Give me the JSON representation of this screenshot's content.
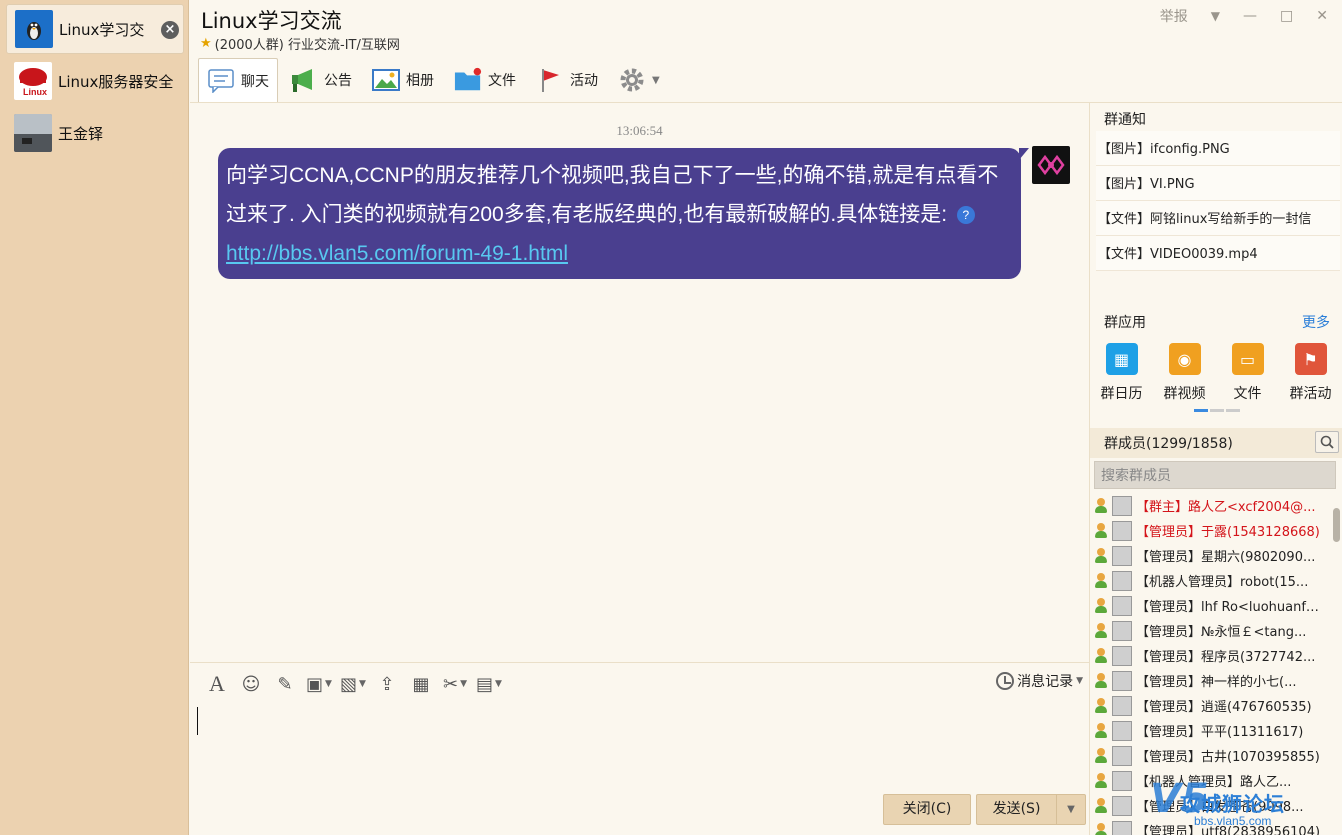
{
  "conversations": [
    {
      "name": "Linux学习交",
      "active": true
    },
    {
      "name": "Linux服务器安全",
      "active": false
    },
    {
      "name": "王金铎",
      "active": false
    }
  ],
  "header": {
    "title": "Linux学习交流",
    "subtitle": "(2000人群) 行业交流-IT/互联网",
    "report": "举报"
  },
  "tabs": [
    {
      "label": "聊天",
      "icon": "chat-icon"
    },
    {
      "label": "公告",
      "icon": "megaphone-icon"
    },
    {
      "label": "相册",
      "icon": "photo-album-icon"
    },
    {
      "label": "文件",
      "icon": "folder-icon"
    },
    {
      "label": "活动",
      "icon": "flag-icon"
    }
  ],
  "chat": {
    "timestamp": "13:06:54",
    "message_text": "向学习CCNA,CCNP的朋友推荐几个视频吧,我自己下了一些,的确不错,就是有点看不过来了. 入门类的视频就有200多套,有老版经典的,也有最新破解的.具体链接是:",
    "message_link": "http://bbs.vlan5.com/forum-49-1.html"
  },
  "input": {
    "history_label": "消息记录",
    "close_label": "关闭(C)",
    "send_label": "发送(S)"
  },
  "right": {
    "notice_title": "群通知",
    "notices": [
      {
        "kind": "【图片】",
        "name": "ifconfig.PNG"
      },
      {
        "kind": "【图片】",
        "name": "VI.PNG"
      },
      {
        "kind": "【文件】",
        "name": "阿铭linux写给新手的一封信"
      },
      {
        "kind": "【文件】",
        "name": "VIDEO0039.mp4"
      }
    ],
    "apps_title": "群应用",
    "apps_more": "更多",
    "apps": [
      {
        "label": "群日历",
        "icon": "calendar-icon",
        "color": "#1ea0e6"
      },
      {
        "label": "群视频",
        "icon": "video-camera-icon",
        "color": "#f0a020"
      },
      {
        "label": "文件",
        "icon": "folder-icon",
        "color": "#f0a020"
      },
      {
        "label": "群活动",
        "icon": "activity-icon",
        "color": "#e0553a"
      }
    ],
    "members_title": "群成员(1299/1858)",
    "member_search_placeholder": "搜索群成员",
    "members": [
      {
        "text": "【群主】路人乙<xcf2004@...",
        "red": true
      },
      {
        "text": "【管理员】于露(1543128668)",
        "red": true
      },
      {
        "text": "【管理员】星期六(9802090...",
        "red": false
      },
      {
        "text": "【机器人管理员】robot(15...",
        "red": false
      },
      {
        "text": "【管理员】lhf Ro<luohuanfe...",
        "red": false
      },
      {
        "text": "【管理员】№永恒￡<tang...",
        "red": false
      },
      {
        "text": "【管理员】程序员(3727742...",
        "red": false
      },
      {
        "text": "【管理员】神一样的小七(...",
        "red": false
      },
      {
        "text": "【管理员】逍遥(476760535)",
        "red": false
      },
      {
        "text": "【管理员】平平(11311617)",
        "red": false
      },
      {
        "text": "【管理员】古井(1070395855)",
        "red": false
      },
      {
        "text": "【机器人管理员】路人乙...",
        "red": false
      },
      {
        "text": "【管理员】白发苍苍(9098...",
        "red": false
      },
      {
        "text": "【管理员】utf8(2838956104)",
        "red": false
      }
    ]
  },
  "watermark": {
    "line1": "攻城狮论坛",
    "line2": "bbs.vlan5.com"
  }
}
